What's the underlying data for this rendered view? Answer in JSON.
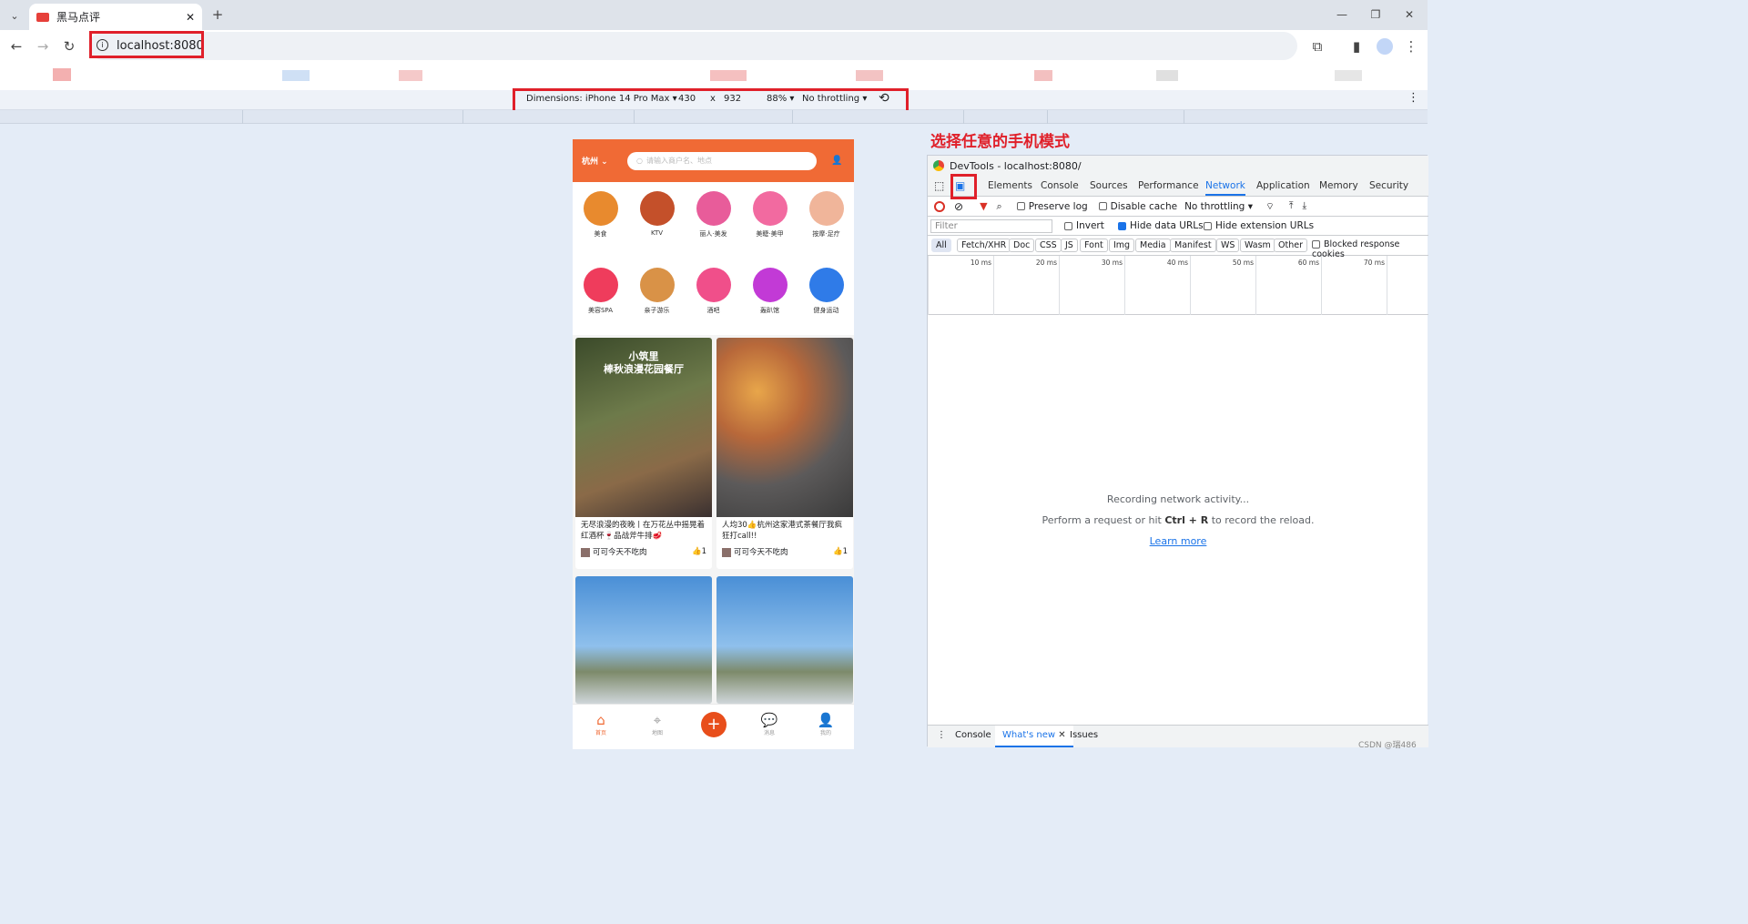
{
  "browser": {
    "tab_title": "黑马点评",
    "url": "localhost:8080"
  },
  "device_toolbar": {
    "device": "Dimensions: iPhone 14 Pro Max",
    "width": "430",
    "times": "x",
    "height": "932",
    "zoom": "88%",
    "throttling": "No throttling"
  },
  "annotation": "选择任意的手机模式",
  "phone": {
    "city": "杭州",
    "search_placeholder": "请输入商户名、地点",
    "categories": [
      {
        "label": "美食",
        "color": "#e88a2e"
      },
      {
        "label": "KTV",
        "color": "#c4502a"
      },
      {
        "label": "丽人·美发",
        "color": "#e85c9a"
      },
      {
        "label": "美睫·美甲",
        "color": "#f26aa0"
      },
      {
        "label": "按摩·足疗",
        "color": "#f0b59a"
      },
      {
        "label": "美容SPA",
        "color": "#ef3c5c"
      },
      {
        "label": "亲子游乐",
        "color": "#d99247"
      },
      {
        "label": "酒吧",
        "color": "#f04f8a"
      },
      {
        "label": "轰趴馆",
        "color": "#c23ad6"
      },
      {
        "label": "健身运动",
        "color": "#2f7be8"
      }
    ],
    "notes": [
      {
        "title": "无尽浪漫的夜晚丨在万花丛中摇晃着红酒杯🍷品战斧牛排🥩",
        "user": "可可今天不吃肉",
        "likes": "1",
        "overlay": "小筑里\n棒秋浪漫花园餐厅"
      },
      {
        "title": "人均30👍杭州这家港式茶餐厅我疯狂打call!!",
        "user": "可可今天不吃肉",
        "likes": "1",
        "overlay": ""
      },
      {
        "title": "",
        "user": "",
        "likes": "",
        "overlay": ""
      },
      {
        "title": "",
        "user": "",
        "likes": "",
        "overlay": ""
      }
    ],
    "tabbar": [
      "首页",
      "地图",
      "",
      "消息",
      "我的"
    ]
  },
  "devtools": {
    "title": "DevTools - localhost:8080/",
    "tabs": [
      "Elements",
      "Console",
      "Sources",
      "Performance",
      "Network",
      "Application",
      "Memory",
      "Security"
    ],
    "active_tab": "Network",
    "preserve_log": "Preserve log",
    "disable_cache": "Disable cache",
    "throttling": "No throttling",
    "filter_placeholder": "Filter",
    "invert": "Invert",
    "hide_data_urls": "Hide data URLs",
    "hide_extension_urls": "Hide extension URLs",
    "types": [
      "All",
      "Fetch/XHR",
      "Doc",
      "CSS",
      "JS",
      "Font",
      "Img",
      "Media",
      "Manifest",
      "WS",
      "Wasm",
      "Other"
    ],
    "blocked": "Blocked response cookies",
    "ticks": [
      "10 ms",
      "20 ms",
      "30 ms",
      "40 ms",
      "50 ms",
      "60 ms",
      "70 ms"
    ],
    "recording": "Recording network activity...",
    "hint_pre": "Perform a request or hit ",
    "hint_key": "Ctrl + R",
    "hint_post": " to record the reload.",
    "learn_more": "Learn more",
    "drawer_tabs": [
      "Console",
      "What's new",
      "Issues"
    ]
  },
  "watermark": "CSDN @瑞486"
}
